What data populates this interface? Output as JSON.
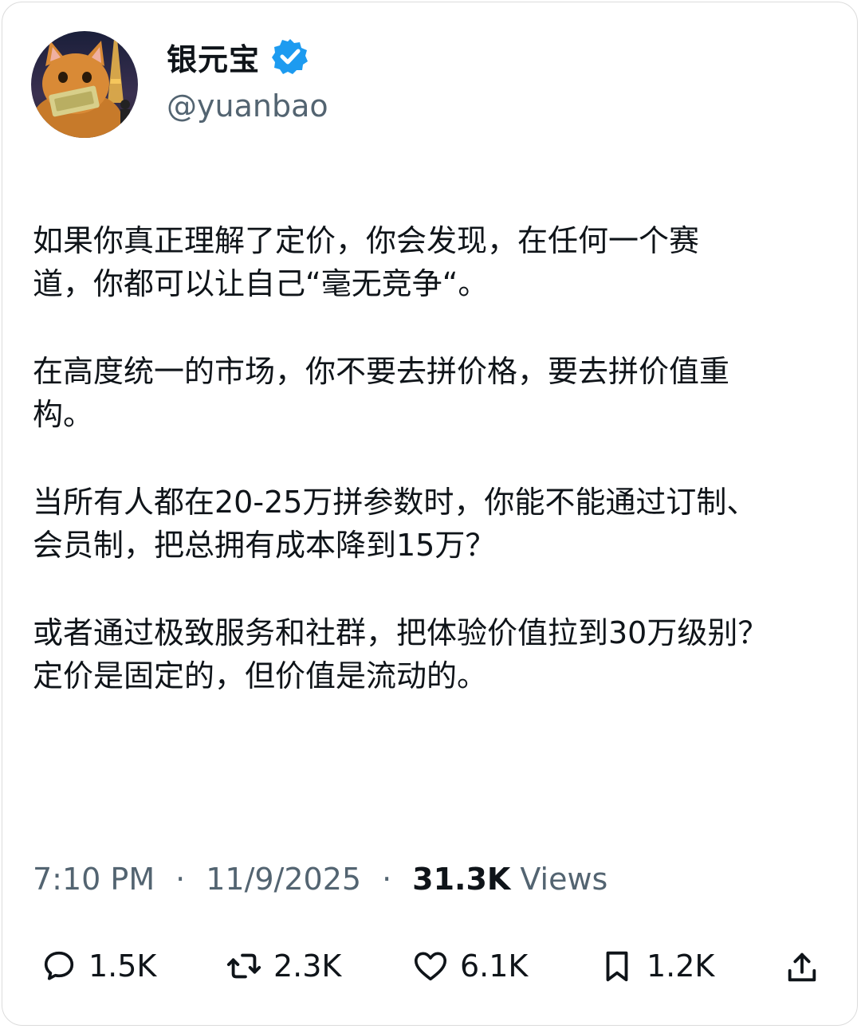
{
  "author": {
    "display_name": "银元宝",
    "handle": "@yuanbao",
    "verified_color": "#1d9bf0"
  },
  "post": {
    "paragraphs": [
      [
        "如果你真正理解了定价，你会发现，在任何一个赛",
        "道，你都可以让自己“毫无竞争“。"
      ],
      [
        "在高度统一的市场，你不要去拼价格，要去拼价值重",
        "构。"
      ],
      [
        "当所有人都在20-25万拼参数时，你能不能通过订制、",
        "会员制，把总拥有成本降到15万？"
      ],
      [
        "或者通过极致服务和社群，把体验价值拉到30万级别？",
        "定价是固定的，但价值是流动的。"
      ]
    ]
  },
  "meta": {
    "time": "7:10 PM",
    "date": "11/9/2025",
    "separator": "·",
    "views_count": "31.3K",
    "views_label": "Views"
  },
  "actions": {
    "replies": "1.5K",
    "reposts": "2.3K",
    "likes": "6.1K",
    "bookmarks": "1.2K"
  },
  "icons": [
    "avatar-cat-image",
    "verified-badge-icon",
    "reply-icon",
    "repost-icon",
    "like-icon",
    "bookmark-icon",
    "share-icon"
  ]
}
